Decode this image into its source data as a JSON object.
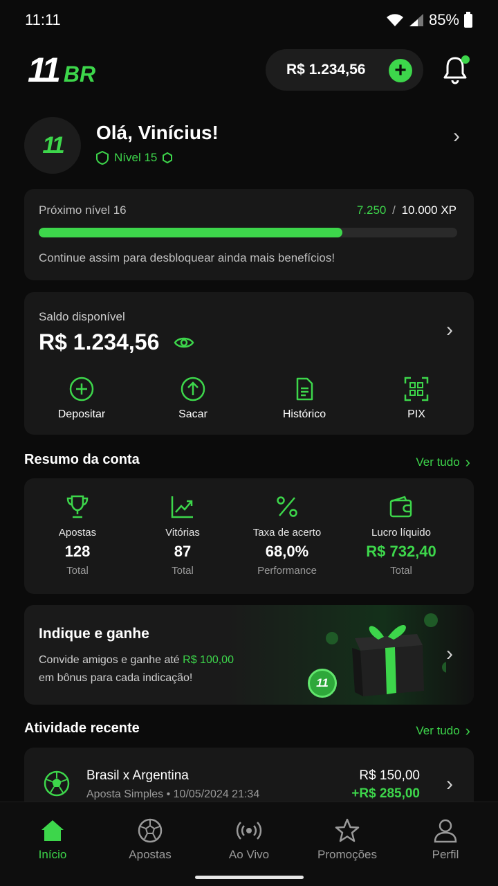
{
  "status_bar": {
    "time": "11:11",
    "battery": "85%"
  },
  "header": {
    "logo_main": "11",
    "logo_suffix": "BR",
    "balance": "R$ 1.234,56",
    "add_symbol": "+"
  },
  "profile": {
    "avatar_text": "11",
    "greeting": "Olá, Vinícius!",
    "level": "Nível 15"
  },
  "xp": {
    "next_level_label": "Próximo nível 16",
    "current": "7.250",
    "separator": "/",
    "goal": "10.000 XP",
    "progress_fraction": 0.725,
    "hint": "Continue assim para desbloquear ainda mais benefícios!"
  },
  "wallet": {
    "label": "Saldo disponível",
    "value": "R$ 1.234,56",
    "actions": [
      {
        "label": "Depositar",
        "icon": "plus-circle-icon"
      },
      {
        "label": "Sacar",
        "icon": "arrow-up-circle-icon"
      },
      {
        "label": "Histórico",
        "icon": "document-icon"
      },
      {
        "label": "PIX",
        "icon": "qr-code-icon"
      }
    ]
  },
  "summary": {
    "title": "Resumo da conta",
    "see_all": "Ver tudo",
    "stats": [
      {
        "label": "Apostas",
        "value": "128",
        "sub": "Total",
        "icon": "trophy-icon"
      },
      {
        "label": "Vitórias",
        "value": "87",
        "sub": "Total",
        "icon": "chart-up-icon"
      },
      {
        "label": "Taxa de acerto",
        "value": "68,0%",
        "sub": "Performance",
        "icon": "percent-icon"
      },
      {
        "label": "Lucro líquido",
        "value": "R$ 732,40",
        "sub": "Total",
        "icon": "wallet-icon"
      }
    ]
  },
  "promo": {
    "title": "Indique e ganhe",
    "text_before": "Convide amigos e ganhe até ",
    "highlight": "R$ 100,00",
    "text_after": "em bônus para cada indicação!",
    "coin_text": "11"
  },
  "activity": {
    "title": "Atividade recente",
    "see_all": "Ver tudo",
    "items": [
      {
        "match": "Brasil x Argentina",
        "details": "Aposta Simples • 10/05/2024 21:34",
        "amount": "R$ 150,00",
        "win": "+R$ 285,00"
      }
    ]
  },
  "nav": {
    "items": [
      {
        "label": "Início",
        "icon": "home-icon",
        "active": true
      },
      {
        "label": "Apostas",
        "icon": "soccer-ball-icon",
        "active": false
      },
      {
        "label": "Ao Vivo",
        "icon": "live-broadcast-icon",
        "active": false
      },
      {
        "label": "Promoções",
        "icon": "star-icon",
        "active": false
      },
      {
        "label": "Perfil",
        "icon": "user-icon",
        "active": false
      }
    ]
  },
  "colors": {
    "accent": "#3dd64b",
    "background": "#0b0b0b",
    "card": "#181818"
  }
}
